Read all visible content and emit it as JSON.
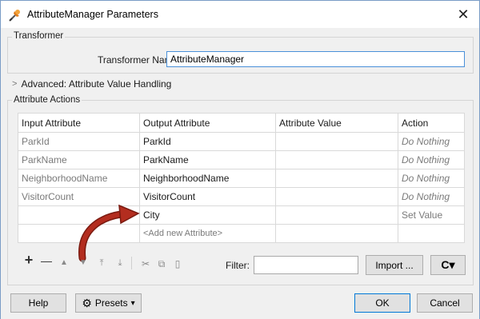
{
  "window": {
    "title": "AttributeManager Parameters",
    "close_glyph": "✕"
  },
  "transformer_group": {
    "label": "Transformer",
    "name_label": "Transformer Name:",
    "name_value": "AttributeManager"
  },
  "advanced": {
    "label": "Advanced: Attribute Value Handling"
  },
  "actions_group": {
    "label": "Attribute Actions",
    "columns": [
      "Input Attribute",
      "Output Attribute",
      "Attribute Value",
      "Action"
    ],
    "rows": [
      {
        "input": "ParkId",
        "output": "ParkId",
        "value": "",
        "action": "Do Nothing"
      },
      {
        "input": "ParkName",
        "output": "ParkName",
        "value": "",
        "action": "Do Nothing"
      },
      {
        "input": "NeighborhoodName",
        "output": "NeighborhoodName",
        "value": "",
        "action": "Do Nothing"
      },
      {
        "input": "VisitorCount",
        "output": "VisitorCount",
        "value": "",
        "action": "Do Nothing"
      },
      {
        "input": "",
        "output": "City",
        "value": "",
        "action": "Set Value"
      }
    ],
    "add_new_placeholder": "<Add new Attribute>"
  },
  "toolbar": {
    "add_glyph": "+",
    "remove_glyph": "—",
    "move_up_glyph": "▲",
    "move_down_glyph": "▼",
    "move_top_glyph": "⤒",
    "move_bottom_glyph": "⤓",
    "cut_glyph": "✂",
    "copy_glyph": "⧉",
    "paste_glyph": "▯",
    "filter_label": "Filter:",
    "filter_value": "",
    "import_label": "Import ...",
    "refresh_glyph": "C▾"
  },
  "footer": {
    "help_label": "Help",
    "presets_label": "Presets",
    "presets_caret": "▾",
    "ok_label": "OK",
    "cancel_label": "Cancel"
  },
  "colors": {
    "accent": "#0078d7",
    "arrow": "#b32d1f",
    "window_bg": "#f0f0f0"
  }
}
